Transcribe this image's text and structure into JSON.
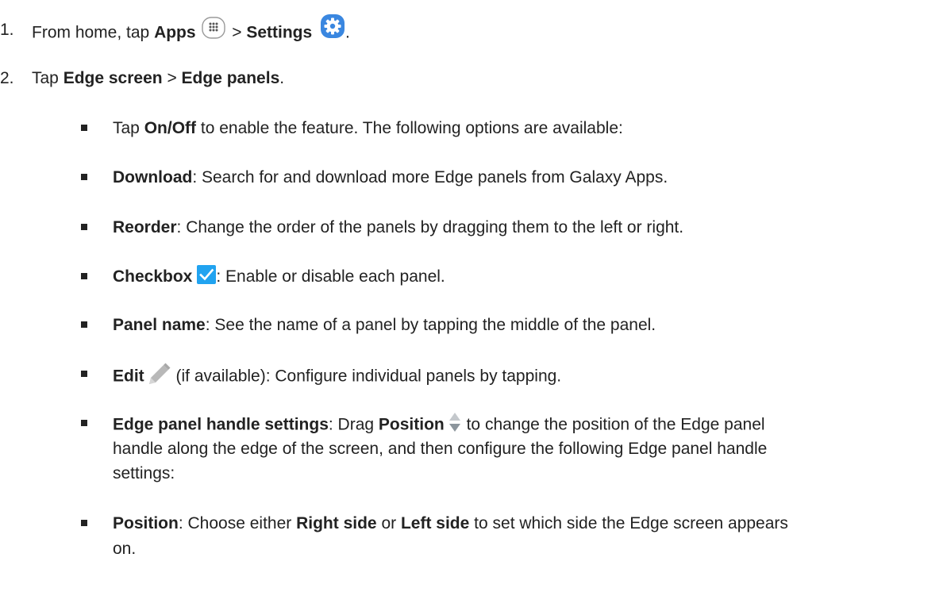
{
  "steps": [
    {
      "number": "1.",
      "prefix": "From home, tap ",
      "apps_label": "Apps",
      "sep": " > ",
      "settings_label": "Settings",
      "suffix": "."
    },
    {
      "number": "2.",
      "prefix": "Tap ",
      "bold1": "Edge screen",
      "sep": " > ",
      "bold2": "Edge panels",
      "suffix": "."
    }
  ],
  "bullets": {
    "onoff": {
      "pre": "Tap ",
      "bold": "On/Off",
      "rest": " to enable the feature. The following options are available:"
    },
    "download": {
      "bold": "Download",
      "rest": ": Search for and download more Edge panels from Galaxy Apps."
    },
    "reorder": {
      "bold": "Reorder",
      "rest": ": Change the order of the panels by dragging them to the left or right."
    },
    "checkbox": {
      "bold": "Checkbox",
      "rest": ": Enable or disable each panel."
    },
    "panel_name": {
      "bold": "Panel name",
      "rest": ": See the name of a panel by tapping the middle of the panel."
    },
    "edit": {
      "bold": "Edit",
      "rest": " (if available): Configure individual panels by tapping."
    },
    "handle": {
      "bold": "Edge panel handle settings",
      "mid": ": Drag ",
      "bold2": "Position",
      "line1_rest": " to change the position of the Edge panel",
      "line2": "handle along the edge of the screen, and then configure the following Edge panel handle",
      "line3": "settings:"
    },
    "position": {
      "bold": "Position",
      "mid1": ": Choose either ",
      "bold2": "Right side",
      "mid2": " or ",
      "bold3": "Left side",
      "line1_rest": " to set which side the Edge screen appears",
      "line2": "on."
    }
  },
  "icons": {
    "apps": "apps-grid-icon",
    "settings": "settings-gear-icon",
    "checkbox": "checkbox-checked-icon",
    "edit": "pencil-edit-icon",
    "position": "position-up-down-icon"
  },
  "colors": {
    "text": "#222222",
    "settings_blue": "#3a87e0",
    "checkbox_blue": "#21a3f0",
    "edit_gray": "#b8b8b8",
    "position_gray": "#9aa2a8"
  }
}
